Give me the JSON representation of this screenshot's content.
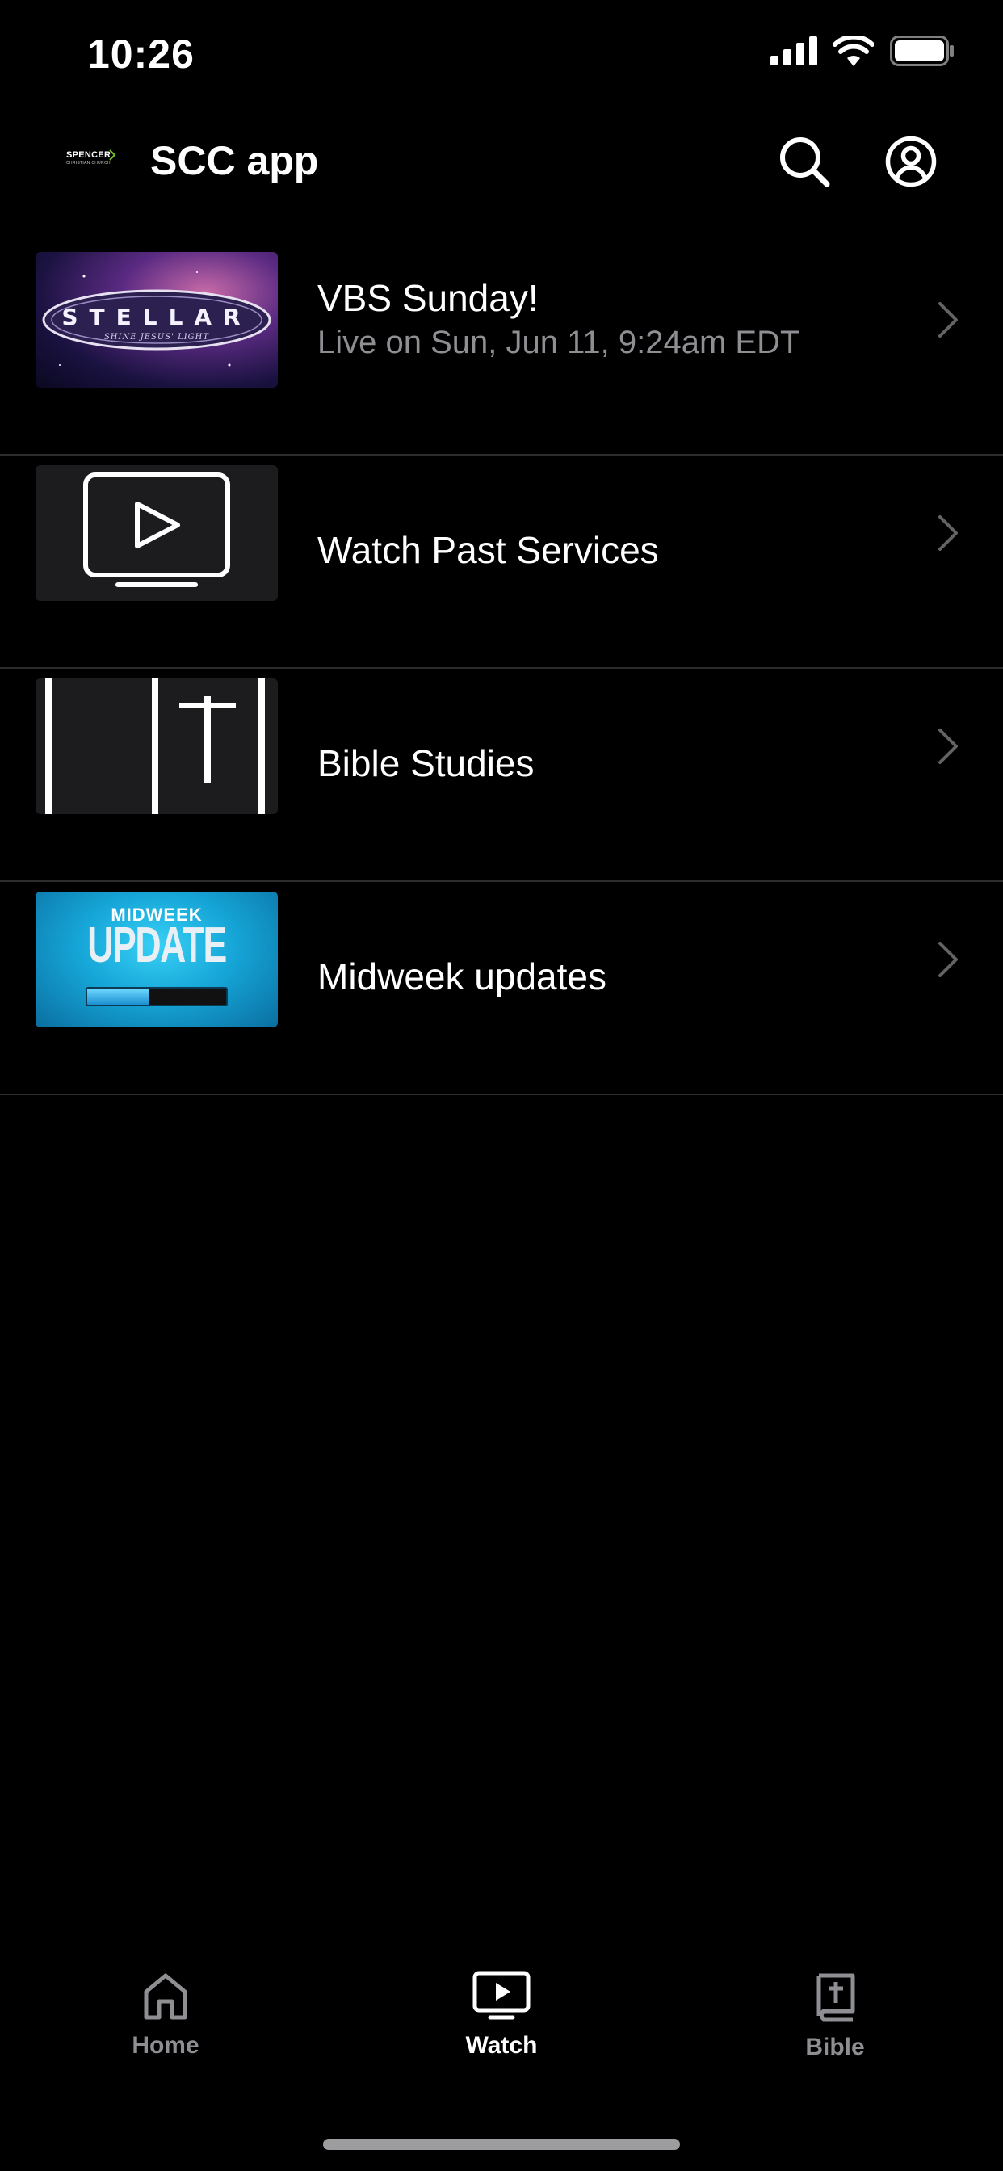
{
  "status_bar": {
    "time": "10:26"
  },
  "header": {
    "logo_text": "SPENCER",
    "logo_subtext": "CHRISTIAN CHURCH",
    "title": "SCC app"
  },
  "items": [
    {
      "title": "VBS Sunday!",
      "subtitle": "Live on Sun, Jun 11, 9:24am EDT",
      "thumbnail": {
        "word": "STELLAR",
        "tagline": "SHINE JESUS' LIGHT"
      }
    },
    {
      "title": "Watch Past Services",
      "subtitle": ""
    },
    {
      "title": "Bible Studies",
      "subtitle": ""
    },
    {
      "title": "Midweek updates",
      "subtitle": "",
      "thumbnail": {
        "line1": "MIDWEEK",
        "line2": "UPDATE",
        "progress": 0.45
      }
    }
  ],
  "tabs": [
    {
      "label": "Home",
      "icon": "home-icon",
      "active": false
    },
    {
      "label": "Watch",
      "icon": "tv-icon",
      "active": true
    },
    {
      "label": "Bible",
      "icon": "bible-icon",
      "active": false
    }
  ],
  "colors": {
    "background": "#000000",
    "divider": "#2c2c2e",
    "muted": "#8e8e93",
    "midweek_blue": "#1aa7d9"
  }
}
